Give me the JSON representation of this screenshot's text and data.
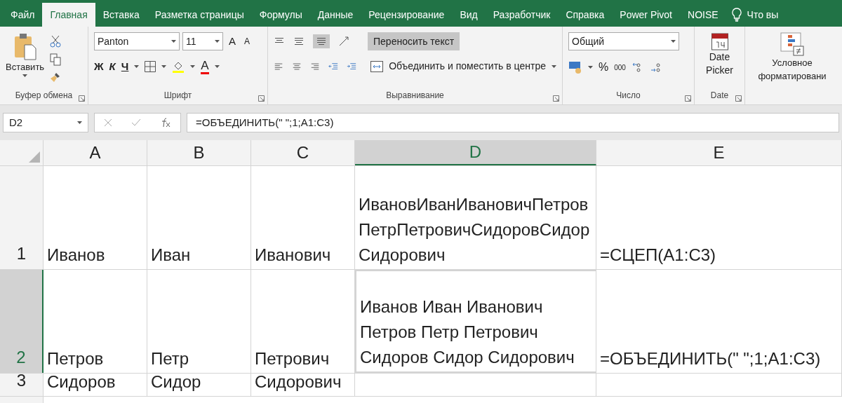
{
  "tabs": [
    {
      "label": "Файл",
      "selected": false
    },
    {
      "label": "Главная",
      "selected": true
    },
    {
      "label": "Вставка",
      "selected": false
    },
    {
      "label": "Разметка страницы",
      "selected": false
    },
    {
      "label": "Формулы",
      "selected": false
    },
    {
      "label": "Данные",
      "selected": false
    },
    {
      "label": "Рецензирование",
      "selected": false
    },
    {
      "label": "Вид",
      "selected": false
    },
    {
      "label": "Разработчик",
      "selected": false
    },
    {
      "label": "Справка",
      "selected": false
    },
    {
      "label": "Power Pivot",
      "selected": false
    },
    {
      "label": "NOISE",
      "selected": false
    }
  ],
  "tell_me": "Что вы",
  "clipboard": {
    "paste": "Вставить",
    "label": "Буфер обмена"
  },
  "font": {
    "name": "Panton",
    "size": "11",
    "grow": "A",
    "shrink": "A",
    "bold": "Ж",
    "italic": "К",
    "underline": "Ч",
    "font_color": "A",
    "label": "Шрифт"
  },
  "alignment": {
    "wrap_text": {
      "label": "Переносить текст",
      "on": true
    },
    "merge": "Объединить и поместить в центре",
    "label": "Выравнивание"
  },
  "number": {
    "format": "Общий",
    "percent": "%",
    "thousands": "000",
    "label": "Число"
  },
  "date": {
    "button": "Date Picker",
    "label": "Date"
  },
  "conditional": "Условное форматировани",
  "name_box": "D2",
  "formula": "=ОБЪЕДИНИТЬ(\" \";1;A1:C3)",
  "columns": [
    {
      "label": "A",
      "selected": false
    },
    {
      "label": "B",
      "selected": false
    },
    {
      "label": "C",
      "selected": false
    },
    {
      "label": "D",
      "selected": true
    },
    {
      "label": "E",
      "selected": false
    }
  ],
  "rows": [
    {
      "header": "1",
      "selected": false,
      "cells": [
        "Иванов",
        "Иван",
        "Иванович",
        "ИвановИванИвановичПетровПетрПетровичСидоровСидорСидорович",
        "=СЦЕП(A1:C3)"
      ]
    },
    {
      "header": "2",
      "selected": true,
      "cells": [
        "Петров",
        "Петр",
        "Петрович",
        "Иванов Иван Иванович Петров Петр Петрович Сидоров Сидор Сидорович",
        "=ОБЪЕДИНИТЬ(\" \";1;A1:C3)"
      ]
    },
    {
      "header": "3",
      "selected": false,
      "cells": [
        "Сидоров",
        "Сидор",
        "Сидорович",
        "",
        ""
      ]
    }
  ]
}
